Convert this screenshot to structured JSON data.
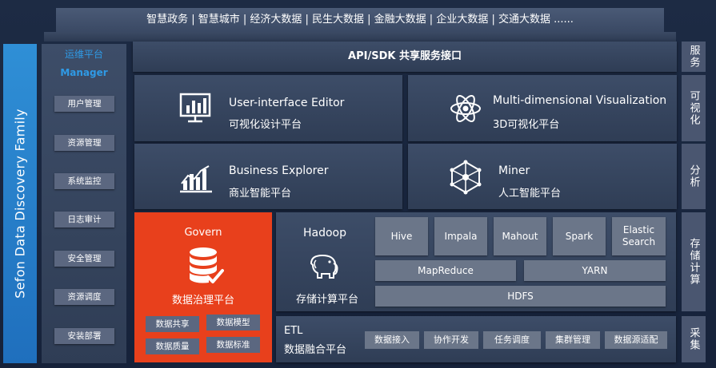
{
  "top_bar": {
    "text": "智慧政务 | 智慧城市 | 经济大数据 | 民生大数据 | 金融大数据 | 企业大数据 | 交通大数据 ......"
  },
  "family": {
    "label": "Sefon Data Discovery Family"
  },
  "ops": {
    "title": "运维平台",
    "subtitle": "Manager",
    "items": [
      "用户管理",
      "资源管理",
      "系统监控",
      "日志审计",
      "安全管理",
      "资源调度",
      "安装部署"
    ]
  },
  "api": {
    "title": "API/SDK 共享服务接口"
  },
  "cards": {
    "editor": {
      "title": "User-interface Editor",
      "sub": "可视化设计平台",
      "icon": "bar-chart-monitor-icon"
    },
    "visual": {
      "title": "Multi-dimensional Visualization",
      "sub": "3D可视化平台",
      "icon": "atom-icon"
    },
    "business": {
      "title": "Business Explorer",
      "sub": "商业智能平台",
      "icon": "trend-chart-icon"
    },
    "miner": {
      "title": "Miner",
      "sub": "人工智能平台",
      "icon": "network-sphere-icon"
    }
  },
  "govern": {
    "title": "Govern",
    "sub": "数据治理平台",
    "icon": "database-check-icon",
    "items": [
      "数据共享",
      "数据模型",
      "数据质量",
      "数据标准"
    ]
  },
  "hadoop": {
    "title": "Hadoop",
    "sub": "存储计算平台",
    "icon": "elephant-icon",
    "tiles": [
      "Hive",
      "Impala",
      "Mahout",
      "Spark",
      "Elastic Search"
    ],
    "mapreduce": "MapReduce",
    "yarn": "YARN",
    "hdfs": "HDFS"
  },
  "etl": {
    "title": "ETL",
    "sub": "数据融合平台",
    "items": [
      "数据接入",
      "协作开发",
      "任务调度",
      "集群管理",
      "数据源适配"
    ]
  },
  "side_labels": [
    "服务",
    "可视化",
    "分析",
    "存储计算",
    "采集"
  ],
  "colors": {
    "accent_blue": "#2f9ae6",
    "govern_red": "#e8401c",
    "family_blue": "#2f8fd6"
  }
}
